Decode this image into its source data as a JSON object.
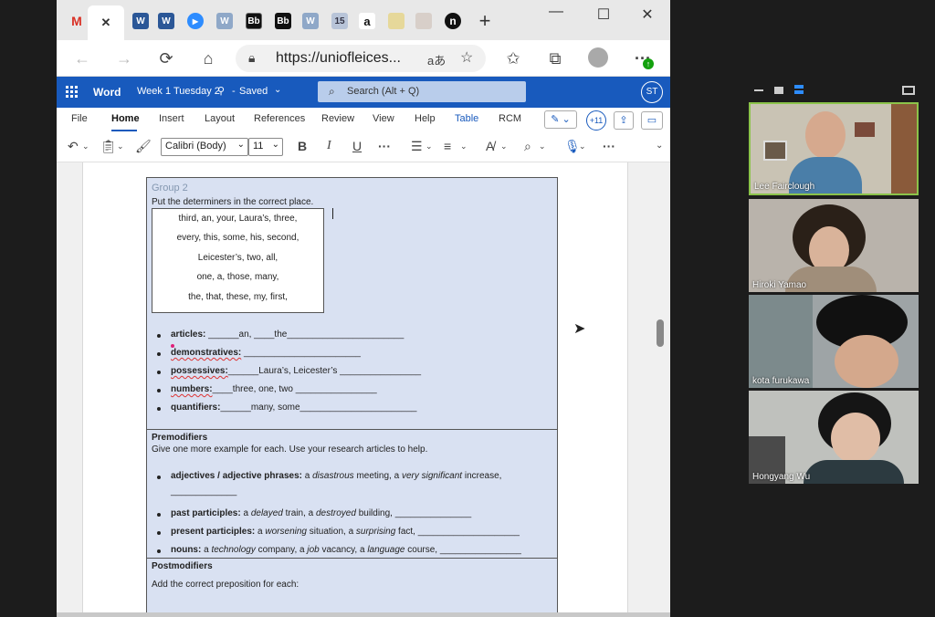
{
  "browser": {
    "tabs": [
      {
        "icon": "gmail-icon",
        "label": "M"
      },
      {
        "icon": "close-icon",
        "label": "✕"
      },
      {
        "icon": "word-icon",
        "label": "W"
      },
      {
        "icon": "word-icon",
        "label": "W"
      },
      {
        "icon": "zoom-icon",
        "label": "▶"
      },
      {
        "icon": "word-icon",
        "label": "W"
      },
      {
        "icon": "blackboard-icon",
        "label": "Bb"
      },
      {
        "icon": "blackboard-icon",
        "label": "Bb"
      },
      {
        "icon": "word-icon",
        "label": "W"
      },
      {
        "icon": "calendar-icon",
        "label": "15"
      },
      {
        "icon": "amazon-icon",
        "label": "a"
      },
      {
        "icon": "image-icon",
        "label": ""
      },
      {
        "icon": "image-icon",
        "label": ""
      },
      {
        "icon": "n-icon",
        "label": "n"
      },
      {
        "icon": "new-tab-icon",
        "label": "+"
      }
    ],
    "url": "https://uniofleices...",
    "read_aloud": "aあ",
    "window_controls": {
      "minimize": "—",
      "maximize": "☐",
      "close": "✕"
    }
  },
  "word": {
    "app_name": "Word",
    "doc_title": "Week 1 Tuesday 2",
    "doc_status": "Saved",
    "search_placeholder": "Search (Alt + Q)",
    "user_initials": "ST",
    "ribbon_tabs": [
      "File",
      "Home",
      "Insert",
      "Layout",
      "References",
      "Review",
      "View",
      "Help",
      "Table",
      "RCM"
    ],
    "active_tab": "Home",
    "collab_count": "+11",
    "font_name": "Calibri (Body)",
    "font_size": "11",
    "format_buttons": {
      "bold": "B",
      "italic": "I",
      "underline": "U",
      "more": "···"
    }
  },
  "doc": {
    "group_title": "Group 2",
    "instruction": "Put the determiners in the correct place.",
    "word_box": [
      "third, an, your, Laura’s, three,",
      "every, this, some, his, second,",
      "Leicester’s, two, all,",
      "one, a, those, many,",
      "the, that, these, my, first,"
    ],
    "determiners": [
      {
        "label": "articles:",
        "rest": " ______an, ____the_______________________"
      },
      {
        "label": "demonstratives:",
        "rest": " _______________________"
      },
      {
        "label": "possessives:",
        "rest": "______Laura’s, Leicester’s ________________"
      },
      {
        "label": "numbers:",
        "rest": "____three, one, two ________________"
      },
      {
        "label": "quantifiers:",
        "rest": "______many, some_______________________"
      }
    ],
    "premodifiers_title": "Premodifiers",
    "premodifiers_instruction": "Give one more example for each. Use your research articles to help.",
    "premodifiers": [
      {
        "label": "adjectives / adjective phrases:",
        "pre": " a ",
        "em1": "disastrous",
        "mid": " meeting, a ",
        "em2": "very significant",
        "post": " increase,",
        "line2": "_____________"
      },
      {
        "label": "past participles:",
        "pre": " a ",
        "em1": "delayed",
        "mid": " train, a ",
        "em2": "destroyed",
        "post": " building, _______________"
      },
      {
        "label": "present participles:",
        "pre": " a ",
        "em1": "worsening",
        "mid": " situation, a ",
        "em2": "surprising",
        "post": " fact, ____________________"
      },
      {
        "label": "nouns:",
        "pre": " a ",
        "em1": "technology",
        "mid": " company, a ",
        "em2": "job",
        "post": " vacancy, a ",
        "em3": "language",
        "post2": " course, ________________"
      }
    ],
    "postmodifiers_title": "Postmodifiers",
    "postmodifiers_instruction": "Add the correct preposition for each:"
  },
  "video": {
    "participants": [
      {
        "name": "Lee Fairclough",
        "bg": "#c9c3b4"
      },
      {
        "name": "Hiroki Yamao",
        "bg": "#b9b3ab"
      },
      {
        "name": "kota furukawa",
        "bg": "#9ea4a6"
      },
      {
        "name": "Hongyang Wu",
        "bg": "#bfc1bd"
      }
    ]
  },
  "colors": {
    "word_blue": "#185abd",
    "table_fill": "#d9e1f2",
    "group_title": "#8497b0"
  }
}
